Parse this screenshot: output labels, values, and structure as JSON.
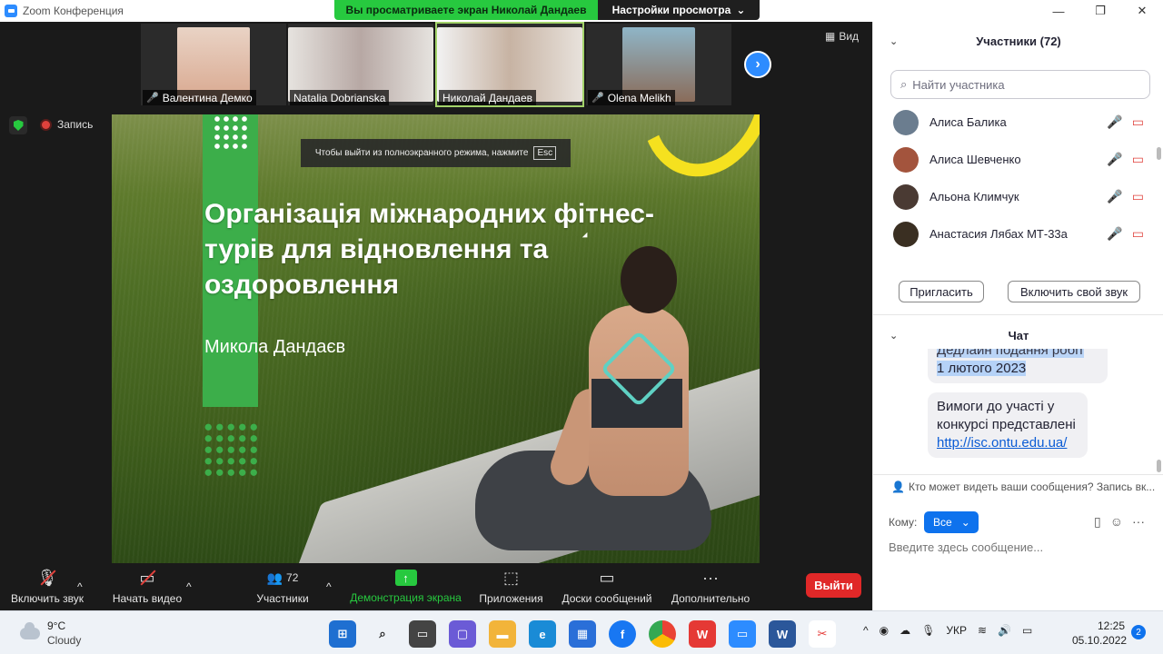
{
  "window": {
    "title": "Zoom Конференция",
    "share_banner": "Вы просматриваете экран Николай Дандаев",
    "view_settings": "Настройки просмотра",
    "view_label": "Вид"
  },
  "participants_strip": [
    {
      "name": "Валентина Демко",
      "muted": true,
      "color": "#d9a88f"
    },
    {
      "name": "Natalia Dobrianska",
      "muted": false,
      "color": "#b7a8a4"
    },
    {
      "name": "Николай Дандаев",
      "muted": false,
      "active": true,
      "color": "#c7b3a3"
    },
    {
      "name": "Olena Melikh",
      "muted": true,
      "color": "#8a6c5a"
    }
  ],
  "recording": {
    "label": "Запись"
  },
  "slide": {
    "esc_hint": "Чтобы выйти из полноэкранного режима, нажмите",
    "esc_key": "Esc",
    "title": "Організація міжнародних фітнес-турів для відновлення та оздоровлення",
    "author": "Микола Дандаєв"
  },
  "toolbar": {
    "audio": "Включить звук",
    "video": "Начать видео",
    "participants": "Участники",
    "participants_count": "72",
    "share": "Демонстрация экрана",
    "apps": "Приложения",
    "whiteboards": "Доски сообщений",
    "more": "Дополнительно",
    "leave": "Выйти"
  },
  "panel": {
    "participants_title": "Участники (72)",
    "search_placeholder": "Найти участника",
    "participants": [
      {
        "name": "Алиса Балика",
        "color": "#6b7d8f"
      },
      {
        "name": "Алиса Шевченко",
        "color": "#a3543d"
      },
      {
        "name": "Альона Климчук",
        "color": "#4a3a33"
      },
      {
        "name": "Анастасия Лябах МТ-33а",
        "color": "#3a2f22"
      }
    ],
    "invite": "Пригласить",
    "unmute_self": "Включить свой звук",
    "chat_title": "Чат",
    "chat_messages": [
      {
        "partial": "Дедлайн подання робіт",
        "line2": "1 лютого 2023"
      },
      {
        "line1": "Вимоги до участі у",
        "line2": "конкурсі представлені",
        "link": "http://isc.ontu.edu.ua/"
      }
    ],
    "who_can_see": "Кто может видеть ваши сообщения? Запись вк...",
    "to_label": "Кому:",
    "to_value": "Все",
    "message_placeholder": "Введите здесь сообщение..."
  },
  "taskbar": {
    "temp": "9°C",
    "weather": "Cloudy",
    "lang": "УКР",
    "time": "12:25",
    "date": "05.10.2022",
    "notifications": "2"
  }
}
